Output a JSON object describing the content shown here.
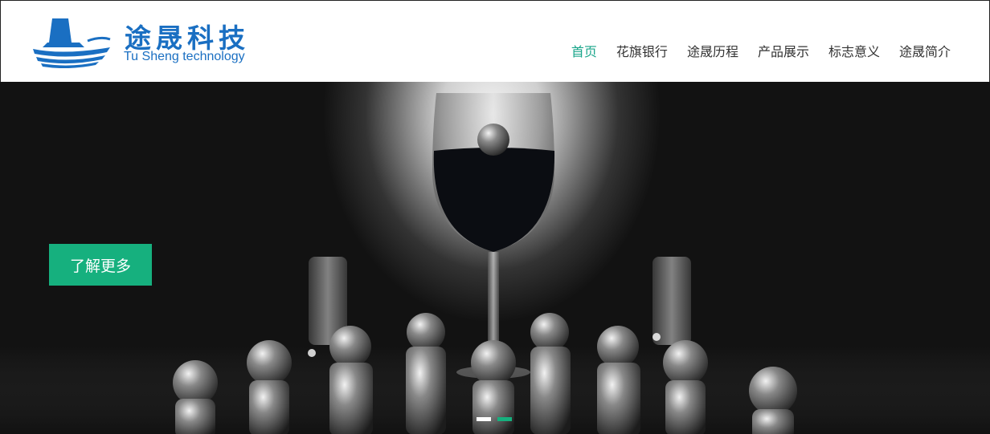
{
  "brand": {
    "name_cn": "途晟科技",
    "name_en": "Tu Sheng technology",
    "color": "#1a6fc2"
  },
  "nav": {
    "items": [
      {
        "label": "首页",
        "active": true
      },
      {
        "label": "花旗银行",
        "active": false
      },
      {
        "label": "途晟历程",
        "active": false
      },
      {
        "label": "产品展示",
        "active": false
      },
      {
        "label": "标志意义",
        "active": false
      },
      {
        "label": "途晟简介",
        "active": false
      }
    ],
    "active_color": "#19a58a"
  },
  "hero": {
    "cta_label": "了解更多",
    "cta_color": "#16b07e",
    "carousel": {
      "slides": 2,
      "active_index": 2
    }
  }
}
